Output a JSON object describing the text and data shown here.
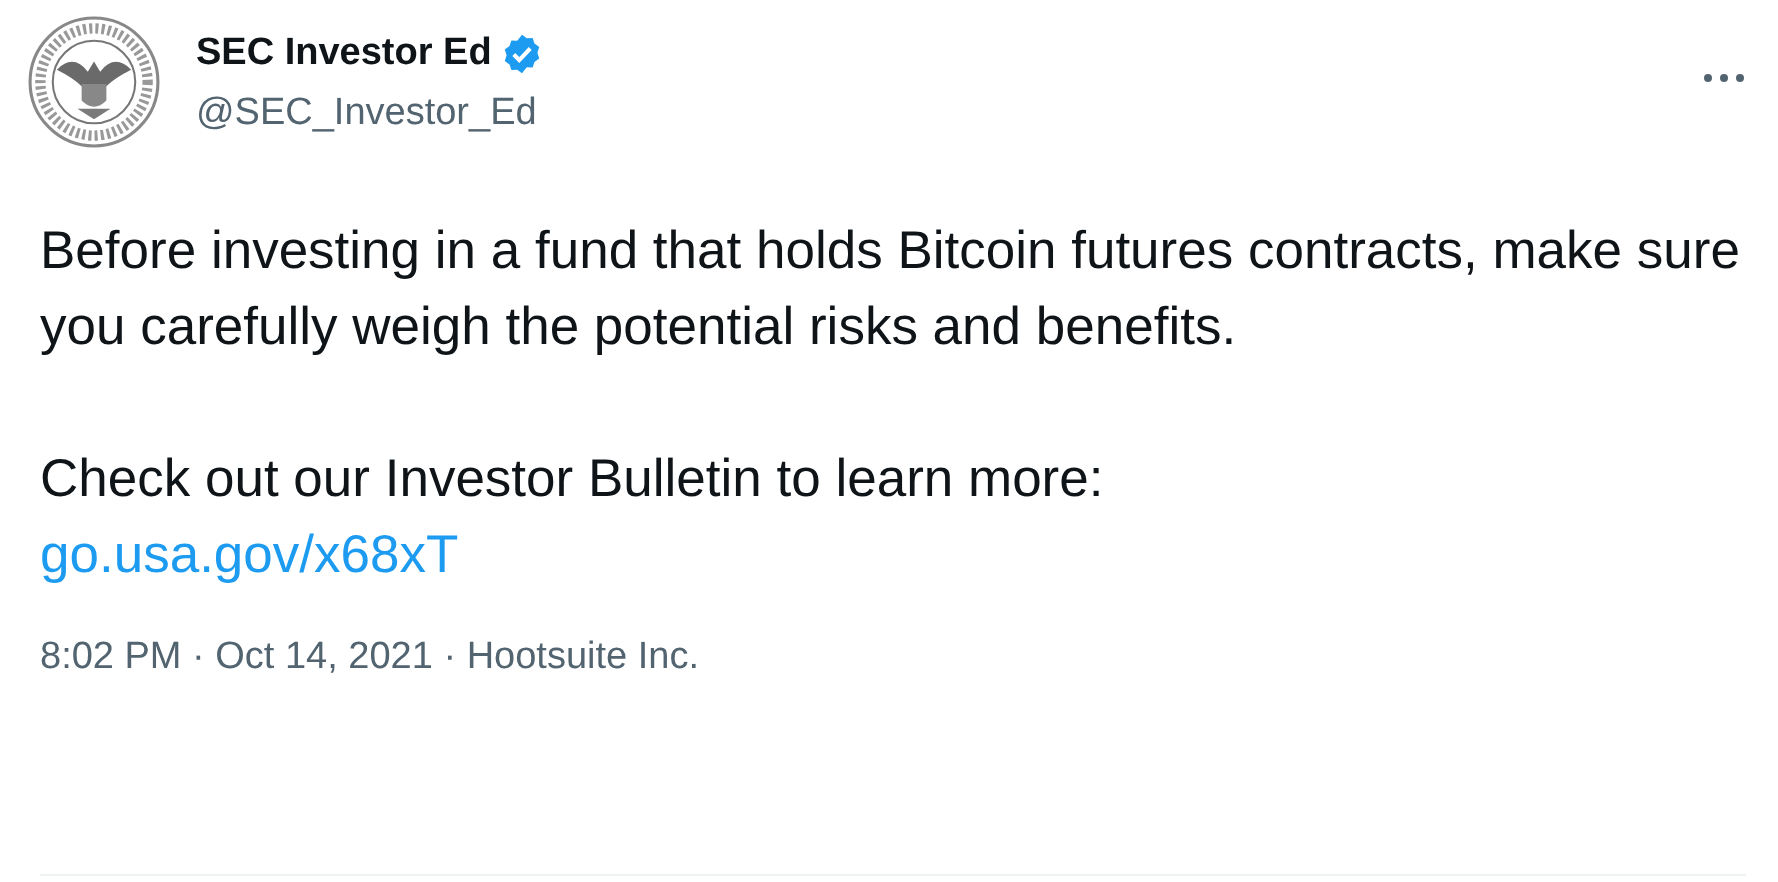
{
  "author": {
    "name": "SEC Investor Ed",
    "verified": true,
    "handle": "@SEC_Investor_Ed"
  },
  "body": {
    "paragraphs": [
      "Before investing in a fund that holds Bitcoin futures contracts, make sure you carefully weigh the potential risks and benefits.",
      "Check out our Investor Bulletin to learn more:"
    ],
    "link": "go.usa.gov/x68xT"
  },
  "meta": "8:02 PM · Oct 14, 2021 · Hootsuite Inc."
}
